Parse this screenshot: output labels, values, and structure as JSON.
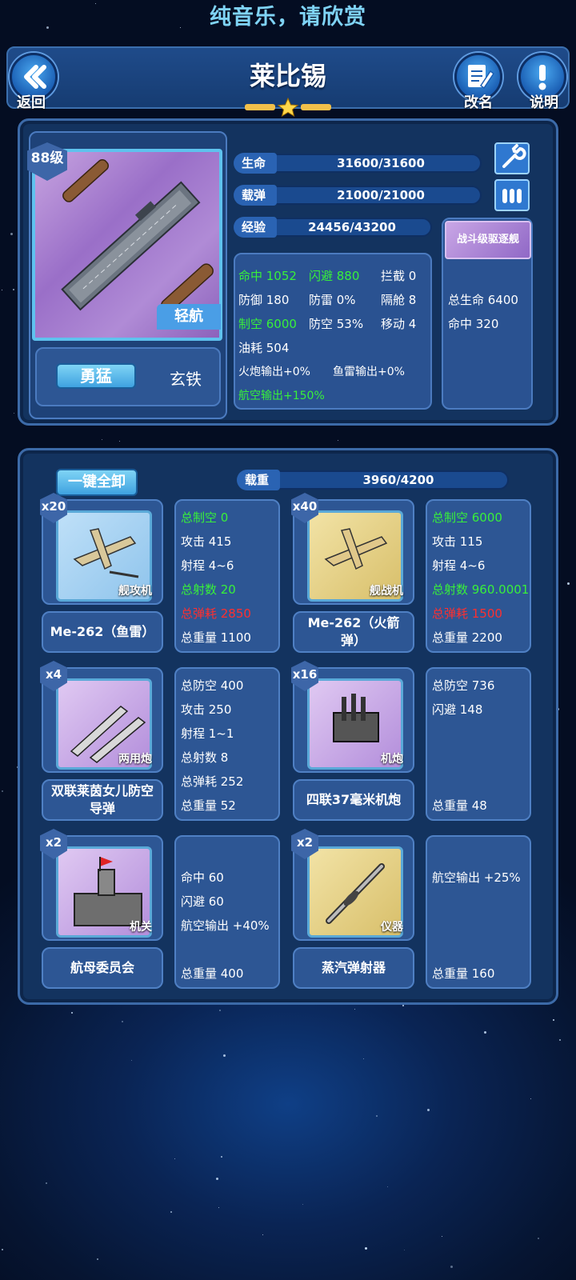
{
  "banner": "纯音乐，请欣赏",
  "header": {
    "title": "莱比锡",
    "back": "返回",
    "rename": "改名",
    "help": "说明"
  },
  "ship": {
    "level": "88级",
    "type": "轻航",
    "trait": "勇猛",
    "material": "玄铁",
    "hp_label": "生命",
    "hp": "31600/31600",
    "hp_fraction": 1.0,
    "ammo_label": "载弹",
    "ammo": "21000/21000",
    "ammo_fraction": 1.0,
    "exp_label": "经验",
    "exp": "24456/43200",
    "exp_fraction": 0.566,
    "stats": {
      "accuracy": "命中 1052",
      "evasion": "闪避 880",
      "intercept": "拦截 0",
      "defense": "防御 180",
      "torpedo_def": "防雷 0%",
      "bulkhead": "隔舱 8",
      "air_control": "制空 6000",
      "anti_air": "防空 53%",
      "move": "移动 4",
      "fuel": "油耗 504",
      "gun_output": "火炮输出+0%",
      "torp_output": "鱼雷输出+0%",
      "air_output": "航空输出+150%"
    },
    "bonus": {
      "title": "战斗级驱逐舰",
      "hp": "总生命 6400",
      "acc": "命中 320"
    }
  },
  "equip_panel": {
    "unload": "一键全卸",
    "load_label": "载重",
    "load": "3960/4200",
    "load_fraction": 0.943
  },
  "equipment": [
    {
      "count": "x20",
      "tag": "舰攻机",
      "name": "Me-262（鱼雷）",
      "stats": [
        {
          "t": "总制空 0",
          "c": "green"
        },
        {
          "t": "攻击 415",
          "c": ""
        },
        {
          "t": "射程 4~6",
          "c": ""
        },
        {
          "t": "总射数 20",
          "c": "green"
        },
        {
          "t": "总弹耗 2850",
          "c": "red"
        },
        {
          "t": "总重量 1100",
          "c": ""
        }
      ]
    },
    {
      "count": "x40",
      "tag": "舰战机",
      "name": "Me-262（火箭弹）",
      "stats": [
        {
          "t": "总制空 6000",
          "c": "green"
        },
        {
          "t": "攻击 115",
          "c": ""
        },
        {
          "t": "射程 4~6",
          "c": ""
        },
        {
          "t": "总射数 960.0001",
          "c": "green"
        },
        {
          "t": "总弹耗 1500",
          "c": "red"
        },
        {
          "t": "总重量 2200",
          "c": ""
        }
      ]
    },
    {
      "count": "x4",
      "tag": "两用炮",
      "name": "双联莱茵女儿防空导弹",
      "stats": [
        {
          "t": "总防空 400",
          "c": ""
        },
        {
          "t": "攻击 250",
          "c": ""
        },
        {
          "t": "射程 1~1",
          "c": ""
        },
        {
          "t": "总射数 8",
          "c": ""
        },
        {
          "t": "总弹耗 252",
          "c": ""
        },
        {
          "t": "总重量 52",
          "c": ""
        }
      ]
    },
    {
      "count": "x16",
      "tag": "机炮",
      "name": "四联37毫米机炮",
      "stats": [
        {
          "t": "总防空 736",
          "c": ""
        },
        {
          "t": "闪避 148",
          "c": ""
        },
        {
          "t": "",
          "c": ""
        },
        {
          "t": "",
          "c": ""
        },
        {
          "t": "",
          "c": ""
        },
        {
          "t": "总重量 48",
          "c": ""
        }
      ]
    },
    {
      "count": "x2",
      "tag": "机关",
      "name": "航母委员会",
      "stats": [
        {
          "t": "",
          "c": ""
        },
        {
          "t": "命中 60",
          "c": ""
        },
        {
          "t": "闪避 60",
          "c": ""
        },
        {
          "t": "航空输出 +40%",
          "c": ""
        },
        {
          "t": "",
          "c": ""
        },
        {
          "t": "总重量 400",
          "c": ""
        }
      ]
    },
    {
      "count": "x2",
      "tag": "仪器",
      "name": "蒸汽弹射器",
      "stats": [
        {
          "t": "",
          "c": ""
        },
        {
          "t": "航空输出 +25%",
          "c": ""
        },
        {
          "t": "",
          "c": ""
        },
        {
          "t": "",
          "c": ""
        },
        {
          "t": "",
          "c": ""
        },
        {
          "t": "总重量 160",
          "c": ""
        }
      ]
    }
  ],
  "icons": {
    "back": "double-chevron-left-icon",
    "rename": "edit-icon",
    "help": "exclamation-icon",
    "wrench": "wrench-icon",
    "ammo": "ammo-icon",
    "rank": "star-icon"
  }
}
